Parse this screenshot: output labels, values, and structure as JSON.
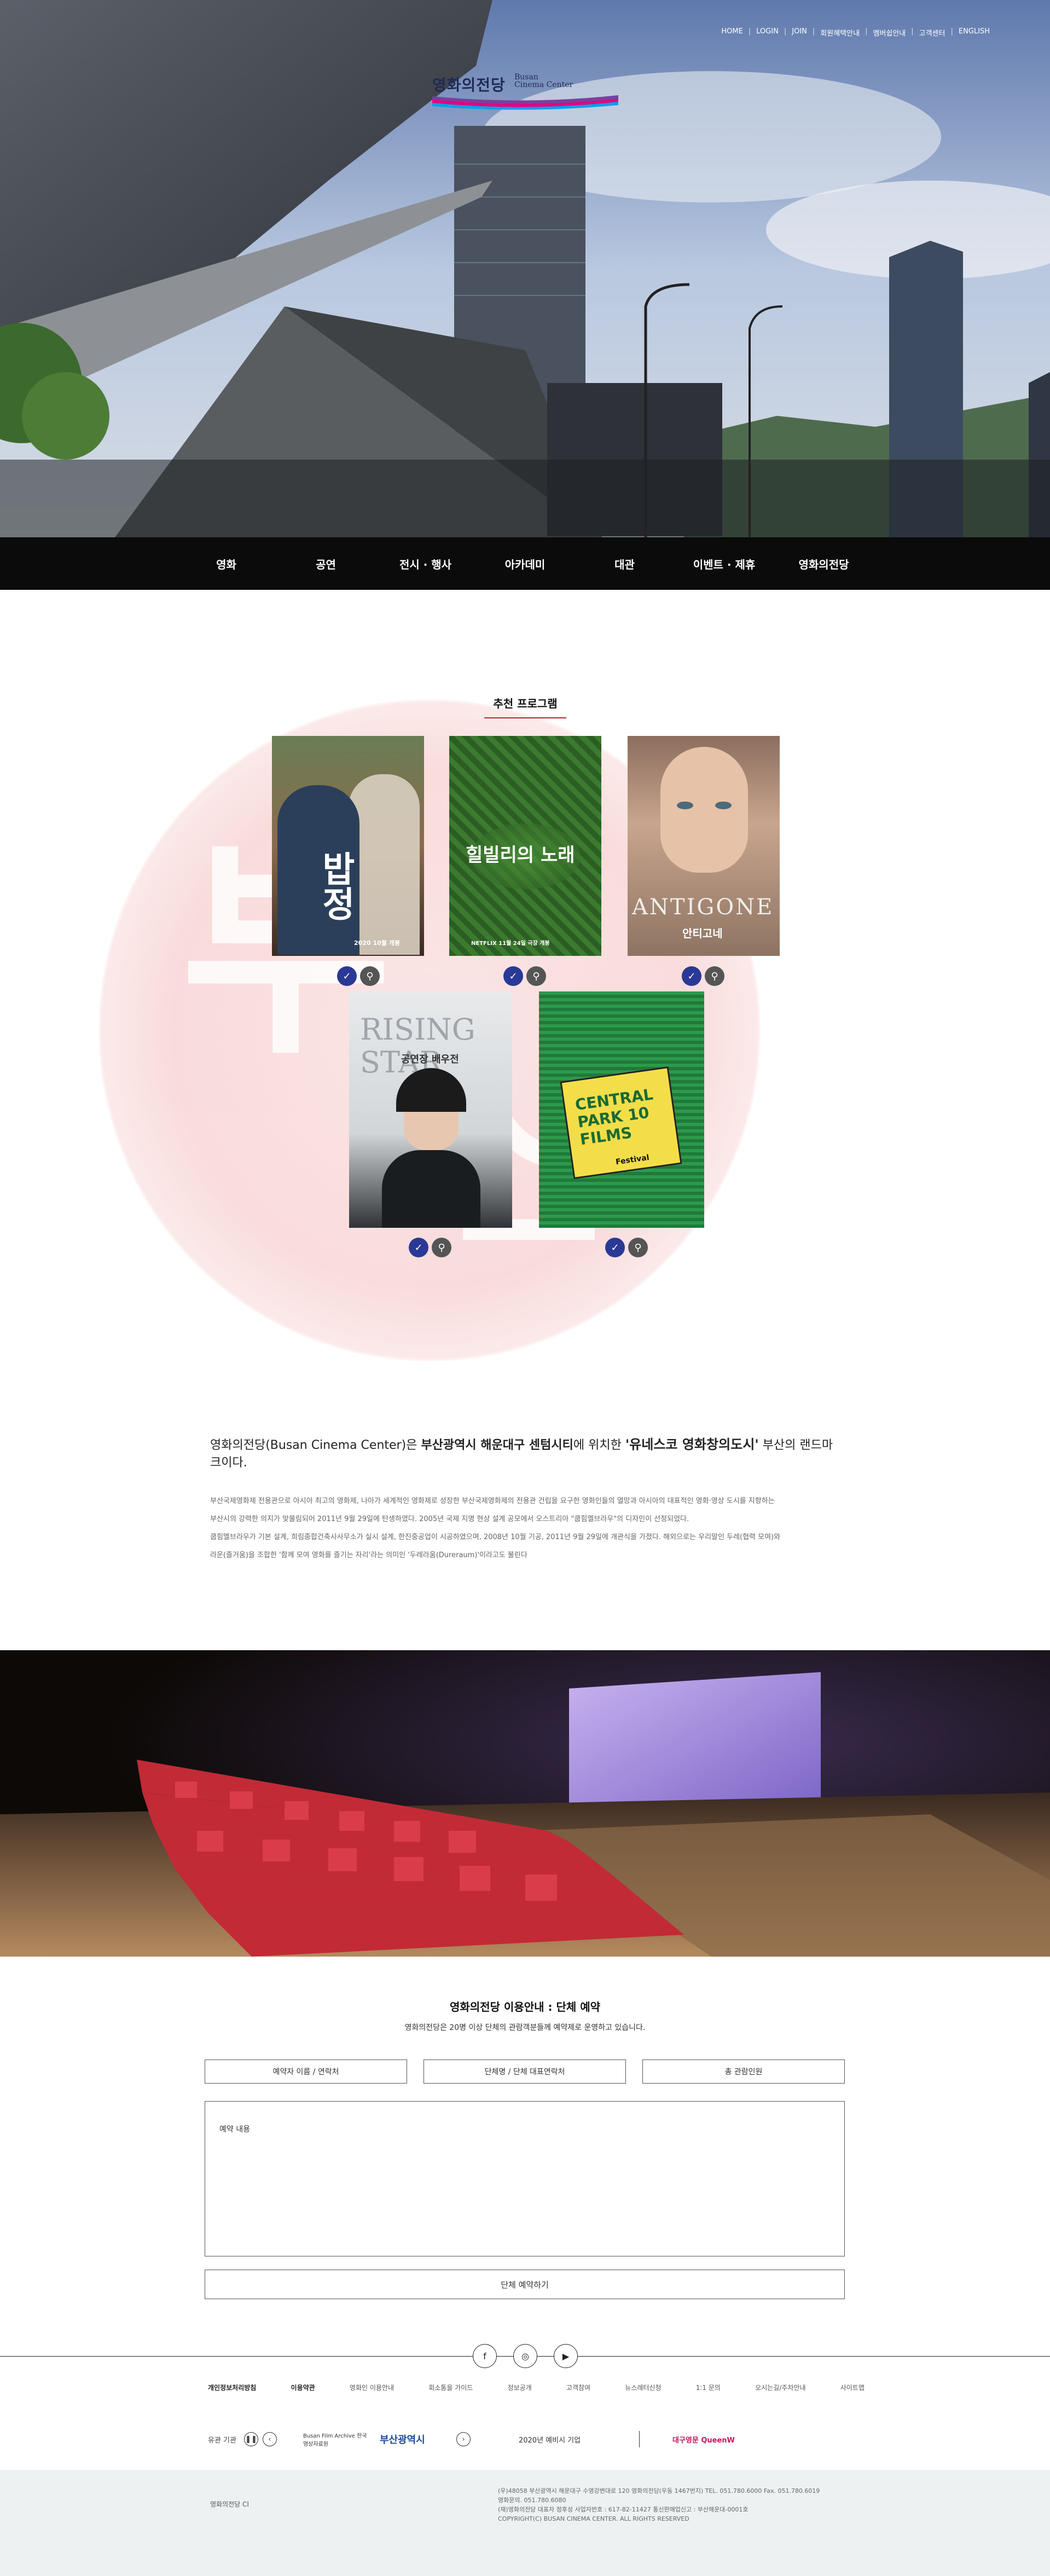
{
  "header": {
    "util_links": [
      "HOME",
      "LOGIN",
      "JOIN",
      "회원혜택안내",
      "멤버쉽안내",
      "고객센터",
      "ENGLISH"
    ],
    "logo": {
      "ko": "영화의전당",
      "en_line1": "Busan",
      "en_line2": "Cinema Center"
    }
  },
  "nav": [
    "영화",
    "공연",
    "전시 · 행사",
    "아카데미",
    "대관",
    "이벤트 · 제휴",
    "영화의전당"
  ],
  "recommend": {
    "title": "추천 프로그램",
    "posters": [
      {
        "title": "밥정",
        "subtitle": "2020 10월 개봉"
      },
      {
        "title": "힐빌리의 노래",
        "subtitle": "NETFLIX 11월 24일 극장 개봉"
      },
      {
        "title": "ANTIGONE",
        "subtitle": "안티고네"
      },
      {
        "title": "RISING STAR",
        "subtitle": "공연장 배우전"
      },
      {
        "title": "CENTRAL PARK 10 FILMS",
        "subtitle": "Festival"
      }
    ]
  },
  "intro": {
    "lead_pre": "영화의전당(Busan Cinema Center)은 ",
    "lead_loc": "부산광역시 해운대구 센텀시티",
    "lead_mid": "에 위치한 ",
    "lead_brand": "'유네스코 영화창의도시'",
    "lead_post": " 부산의 랜드마크이다.",
    "body": [
      "부산국제영화제 전용관으로 아시아 최고의 영화제, 나아가 세계적인 영화제로 성장한 부산국제영화제의 전용관 건립을 요구한 영화인들의 열망과 아시아의 대표적인 영화·영상 도시를 지향하는",
      "부산시의 강력한 의지가 맞물림되어 2011년 9월 29일에 탄생하였다. 2005년 국제 지명 현상 설계 공모에서 오스트리아 \"쿱힘멜브라우\"의 디자인이 선정되었다.",
      "쿱힘멜브라우가 기본 설계, 희림종합건축사사무소가 실시 설계, 한진중공업이 시공하였으며, 2008년 10월 기공, 2011년 9월 29일에 개관식을 가졌다. 해외으로는 우리말인 두레(협력 모여)와",
      "라운(즐거움)을 조합한 '함께 모여 영화를 즐기는 자리'라는 의미인 '두레라움(Dureraum)'이라고도 불린다"
    ]
  },
  "reservation": {
    "title": "영화의전당 이용안내 : 단체 예약",
    "subtitle": "영화의전당은 20명 이상 단체의 관람객분들께 예약제로 운영하고 있습니다.",
    "fields": [
      "예약자 이름 / 연락처",
      "단체명 / 단체 대표연락처",
      "총 관람인원"
    ],
    "textarea_label": "예약 내용",
    "submit": "단체 예약하기"
  },
  "footer": {
    "sns": [
      "f",
      "◎",
      "▶"
    ],
    "menu": [
      "개인정보처리방침",
      "이용약관",
      "영화인 이용안내",
      "회소통을 가이드",
      "정보공개",
      "고객참여",
      "뉴스레터신청",
      "1:1 문의",
      "오시는길/주차안내",
      "사이트맵"
    ],
    "family_label": "유관 기관",
    "family": [
      "Busan Film Archive 한국영상자료원",
      "부산광역시",
      "2020년 예비시 기업",
      "대구영문 QueenW"
    ],
    "copy_logo": "영화의전당 CI",
    "address": [
      "(우)48058 부산광역시 해운대구 수영강변대로 120 영화의전당(우동 1467번지)   TEL. 051.780.6000  Fax. 051.780.6019",
      "영화문의. 051.780.6080",
      "(재)영화의전당  대표자 정후성 사업자번호 : 617-82-11427  통신판매업신고 : 부산해운대-0001호",
      "COPYRIGHT(C) BUSAN CINEMA CENTER. ALL RIGHTS RESERVED"
    ]
  }
}
